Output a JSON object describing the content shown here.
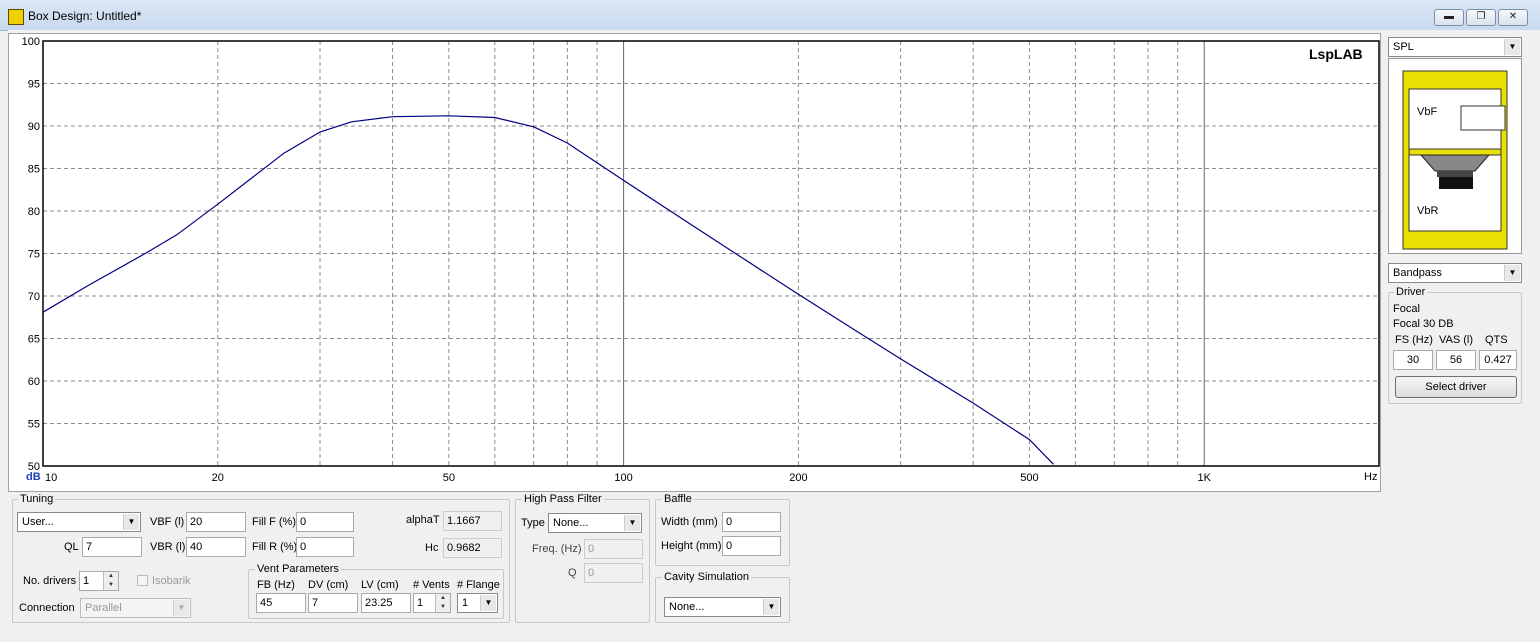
{
  "window": {
    "title": "Box Design: Untitled*"
  },
  "chart": {
    "watermark": "LspLAB",
    "y_unit": "dB",
    "x_unit": "Hz",
    "y_ticks": [
      "100",
      "95",
      "90",
      "85",
      "80",
      "75",
      "70",
      "65",
      "60",
      "55",
      "50"
    ],
    "x_tick_labels": [
      "10",
      "20",
      "50",
      "100",
      "200",
      "500",
      "1K"
    ]
  },
  "chart_data": {
    "type": "line",
    "x_scale": "log",
    "xlim": [
      10,
      2000
    ],
    "ylim": [
      50,
      100
    ],
    "x_tick_values": [
      10,
      20,
      50,
      100,
      200,
      500,
      1000
    ],
    "y_tick_values": [
      100,
      95,
      90,
      85,
      80,
      75,
      70,
      65,
      60,
      55,
      50
    ],
    "grid": true,
    "series": [
      {
        "x": [
          10,
          12,
          15,
          17,
          20,
          23,
          26,
          30,
          34,
          40,
          50,
          60,
          70,
          80,
          100,
          130,
          160,
          200,
          250,
          300,
          400,
          500,
          550
        ],
        "y": [
          68.1,
          71.3,
          75.0,
          77.2,
          80.8,
          84.0,
          86.8,
          89.3,
          90.5,
          91.1,
          91.2,
          91.0,
          89.9,
          88.0,
          83.6,
          78.5,
          74.5,
          70.2,
          66.0,
          62.6,
          57.4,
          53.1,
          50.2
        ],
        "color": "#000080"
      }
    ]
  },
  "right_panel": {
    "view_select": "SPL",
    "diagram": {
      "front_label": "VbF",
      "rear_label": "VbR"
    },
    "box_type_select": "Bandpass",
    "driver": {
      "group_label": "Driver",
      "brand": "Focal",
      "model": "Focal 30 DB",
      "fs_label": "FS (Hz)",
      "vas_label": "VAS (l)",
      "qts_label": "QTS",
      "fs_value": "30",
      "vas_value": "56",
      "qts_value": "0.427",
      "select_button": "Select driver"
    }
  },
  "tuning": {
    "group_label": "Tuning",
    "preset_select": "User...",
    "vbf_label": "VBF (l)",
    "vbf_value": "20",
    "ql_label": "QL",
    "ql_value": "7",
    "vbr_label": "VBR (l)",
    "vbr_value": "40",
    "fillf_label": "Fill F (%)",
    "fillf_value": "0",
    "fillr_label": "Fill R (%)",
    "fillr_value": "0",
    "alphat_label": "alphaT",
    "alphat_value": "1.1667",
    "hc_label": "Hc",
    "hc_value": "0.9682",
    "drivers_label": "No. drivers",
    "drivers_value": "1",
    "isobarik_label": "Isobarik",
    "connection_label": "Connection",
    "connection_select": "Parallel"
  },
  "vent": {
    "group_label": "Vent Parameters",
    "fb_label": "FB (Hz)",
    "dv_label": "DV (cm)",
    "lv_label": "LV (cm)",
    "vents_label": "# Vents",
    "flange_label": "# Flange",
    "fb_value": "45",
    "dv_value": "7",
    "lv_value": "23.25",
    "vents_value": "1",
    "flange_value": "1"
  },
  "hpf": {
    "group_label": "High Pass Filter",
    "type_label": "Type",
    "type_select": "None...",
    "freq_label": "Freq. (Hz)",
    "freq_value": "0",
    "q_label": "Q",
    "q_value": "0"
  },
  "baffle": {
    "group_label": "Baffle",
    "width_label": "Width (mm)",
    "width_value": "0",
    "height_label": "Height (mm)",
    "height_value": "0"
  },
  "cavity": {
    "group_label": "Cavity Simulation",
    "select": "None..."
  }
}
